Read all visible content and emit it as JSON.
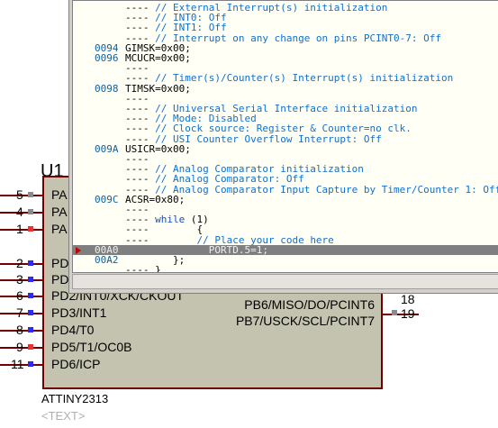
{
  "schematic": {
    "ref": "U1",
    "part": "ATTINY2313",
    "text_placeholder": "<TEXT>",
    "left_pins": [
      {
        "num": "5",
        "name": "PA",
        "dot": "gray"
      },
      {
        "num": "4",
        "name": "PA",
        "dot": "gray"
      },
      {
        "num": "1",
        "name": "PA",
        "dot": "red"
      },
      {
        "num": "2",
        "name": "PD",
        "dot": "blue"
      },
      {
        "num": "3",
        "name": "PD",
        "dot": "blue"
      },
      {
        "num": "6",
        "name": "PD2/INT0/XCK/CKOUT",
        "dot": "blue"
      },
      {
        "num": "7",
        "name": "PD3/INT1",
        "dot": "blue"
      },
      {
        "num": "8",
        "name": "PD4/T0",
        "dot": "blue"
      },
      {
        "num": "9",
        "name": "PD5/T1/OC0B",
        "dot": "red"
      },
      {
        "num": "11",
        "name": "PD6/ICP",
        "dot": "blue"
      }
    ],
    "right_pins": [
      {
        "num": "18",
        "name": "PB6/MISO/DO/PCINT6",
        "dot": "gray"
      },
      {
        "num": "19",
        "name": "PB7/USCK/SCL/PCINT7",
        "dot": "gray"
      }
    ]
  },
  "code_window": {
    "lines": [
      {
        "addr": "",
        "text": "---- // External Interrupt(s) initialization"
      },
      {
        "addr": "",
        "text": "---- // INT0: Off"
      },
      {
        "addr": "",
        "text": "---- // INT1: Off"
      },
      {
        "addr": "",
        "text": "---- // Interrupt on any change on pins PCINT0-7: Off"
      },
      {
        "addr": "0094",
        "text": "GIMSK=0x00;"
      },
      {
        "addr": "0096",
        "text": "MCUCR=0x00;"
      },
      {
        "addr": "",
        "text": "----"
      },
      {
        "addr": "",
        "text": "---- // Timer(s)/Counter(s) Interrupt(s) initialization"
      },
      {
        "addr": "0098",
        "text": "TIMSK=0x00;"
      },
      {
        "addr": "",
        "text": "----"
      },
      {
        "addr": "",
        "text": "---- // Universal Serial Interface initialization"
      },
      {
        "addr": "",
        "text": "---- // Mode: Disabled"
      },
      {
        "addr": "",
        "text": "---- // Clock source: Register & Counter=no clk."
      },
      {
        "addr": "",
        "text": "---- // USI Counter Overflow Interrupt: Off"
      },
      {
        "addr": "009A",
        "text": "USICR=0x00;"
      },
      {
        "addr": "",
        "text": "----"
      },
      {
        "addr": "",
        "text": "---- // Analog Comparator initialization"
      },
      {
        "addr": "",
        "text": "---- // Analog Comparator: Off"
      },
      {
        "addr": "",
        "text": "---- // Analog Comparator Input Capture by Timer/Counter 1: Off"
      },
      {
        "addr": "009C",
        "text": "ACSR=0x80;"
      },
      {
        "addr": "",
        "text": "----"
      },
      {
        "addr": "",
        "text": "---- while (1)"
      },
      {
        "addr": "",
        "text": "----        {"
      },
      {
        "addr": "",
        "text": "----        // Place your code here"
      },
      {
        "addr": "00A0",
        "text": "              PORTD.5=1;"
      },
      {
        "addr": "00A2",
        "text": "        };"
      },
      {
        "addr": "",
        "text": "---- }"
      }
    ],
    "current_line_index": 24
  },
  "colors": {
    "chip_fill": "#c3c3b0",
    "chip_border": "#700000",
    "comment": "#1070d0",
    "highlight": "#7f7f7f",
    "breakpoint_arrow": "#c00000"
  }
}
